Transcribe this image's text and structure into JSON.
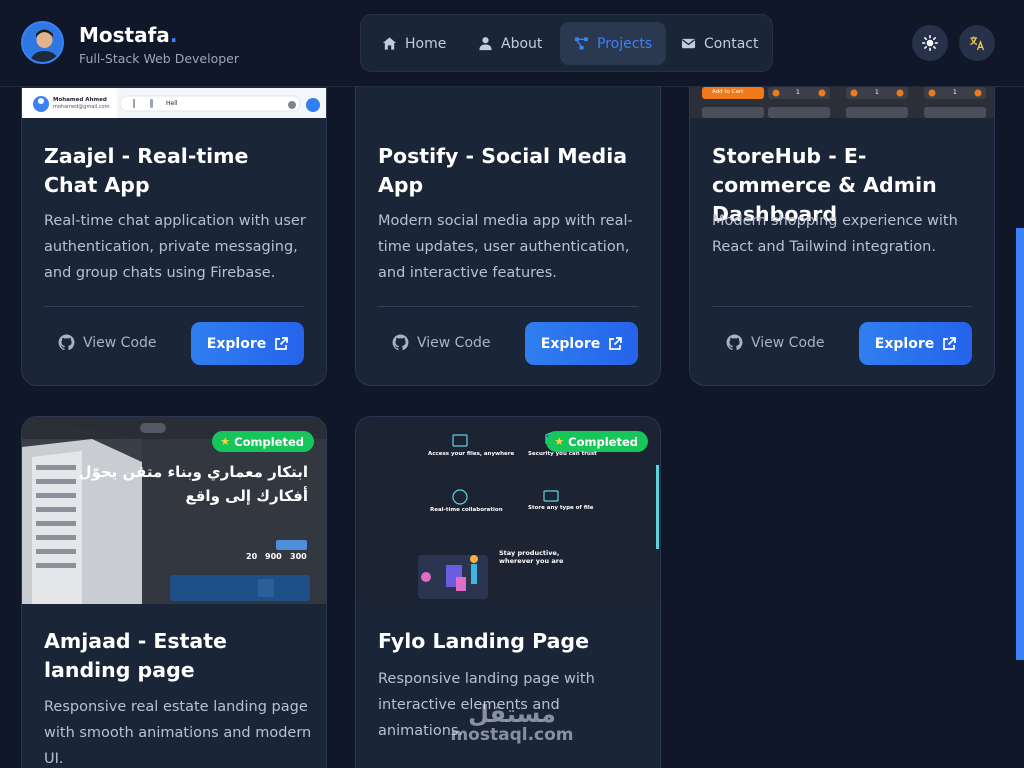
{
  "brand": {
    "name": "Mostafa",
    "dot": ".",
    "subtitle": "Full-Stack Web Developer"
  },
  "nav": [
    {
      "label": "Home",
      "icon": "home-icon",
      "active": false
    },
    {
      "label": "About",
      "icon": "user-icon",
      "active": false
    },
    {
      "label": "Projects",
      "icon": "projects-icon",
      "active": true
    },
    {
      "label": "Contact",
      "icon": "envelope-icon",
      "active": false
    }
  ],
  "header_actions": {
    "theme_icon": "sun-icon",
    "language_icon": "translate-icon"
  },
  "projects": [
    {
      "title": "Zaajel - Real-time Chat App",
      "description": "Real-time chat application with user authentication, private messaging, and group chats using Firebase.",
      "view_code": "View Code",
      "explore": "Explore",
      "thumb": {
        "user_name": "Mohamed Ahmed",
        "user_email": "mohamed@gmail.com",
        "message_input": "Hell"
      }
    },
    {
      "title": "Postify - Social Media App",
      "description": "Modern social media app with real-time updates, user authentication, and interactive features.",
      "view_code": "View Code",
      "explore": "Explore"
    },
    {
      "title": "StoreHub - E-commerce & Admin Dashboard",
      "description": "Modern shopping experience with React and Tailwind integration.",
      "view_code": "View Code",
      "explore": "Explore",
      "thumb": {
        "add_to_cart": "Add to Cart",
        "qty": "1"
      }
    },
    {
      "title": "Amjaad - Estate landing page",
      "description": "Responsive real estate landing page with smooth animations and modern UI.",
      "badge": "Completed",
      "thumb": {
        "headline_line1": "ابتكار معماري وبناء متقن يحوّل",
        "headline_line2": "أفكارك إلى واقع",
        "stats": [
          "20",
          "900",
          "300"
        ]
      }
    },
    {
      "title": "Fylo Landing Page",
      "description": "Responsive landing page with interactive elements and animations.",
      "badge": "Completed",
      "thumb": {
        "features": [
          "Access your files, anywhere",
          "Security you can trust",
          "Real-time collaboration",
          "Store any type of file"
        ],
        "cta": "Stay productive, wherever you are"
      }
    }
  ],
  "watermark": {
    "arabic": "مستقل",
    "latin": "mostaql.com"
  },
  "colors": {
    "background": "#0f1729",
    "card": "#1b2538",
    "accent": "#3b82f6",
    "badge": "#16c65a"
  }
}
